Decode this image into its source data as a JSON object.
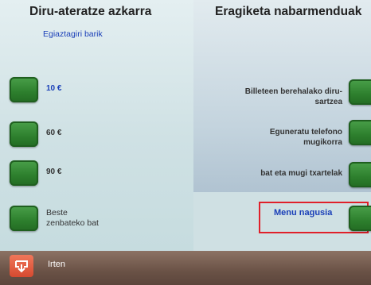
{
  "left": {
    "title": "Diru-ateratze azkarra",
    "subtitle": "Egiaztagiri barik",
    "amounts": [
      {
        "label": "10 €"
      },
      {
        "label": "60 €"
      },
      {
        "label": "90 €"
      }
    ],
    "other": [
      "Beste",
      "zenbateko bat"
    ]
  },
  "right": {
    "title": "Eragiketa nabarmenduak",
    "operations": [
      {
        "lines": [
          "Billeteen berehalako diru-",
          "sartzea"
        ]
      },
      {
        "lines": [
          "Eguneratu telefono",
          "mugikorra"
        ]
      },
      {
        "lines": [
          "bat eta mugi txartelak"
        ]
      }
    ],
    "main_menu": "Menu nagusia"
  },
  "footer": {
    "exit": "Irten"
  },
  "colors": {
    "button_green": "#2d7f2d",
    "link_blue": "#1a3fb8",
    "highlight_red": "#e0202a",
    "exit_orange": "#d64a30"
  }
}
